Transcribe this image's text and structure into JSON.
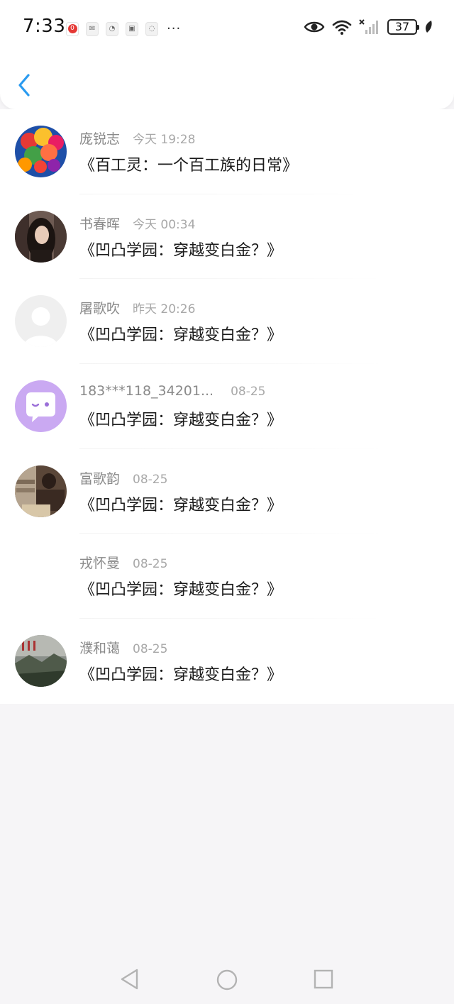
{
  "status_bar": {
    "time": "7:33",
    "notification_badge": "0",
    "more": "···",
    "battery": "37"
  },
  "colors": {
    "accent": "#2a9bf0",
    "name_text": "#8a8a8a",
    "time_text": "#a8a8a8"
  },
  "messages": [
    {
      "name": "庞锐志",
      "time": "今天 19:28",
      "text": "《百工灵：一个百工族的日常》"
    },
    {
      "name": "书春晖",
      "time": "今天 00:34",
      "text": "《凹凸学园：穿越变白金？》"
    },
    {
      "name": "屠歌吹",
      "time": "昨天 20:26",
      "text": "《凹凸学园：穿越变白金？》"
    },
    {
      "name": "183***118_34201...",
      "time": "08-25",
      "text": "《凹凸学园：穿越变白金？》"
    },
    {
      "name": "富歌韵",
      "time": "08-25",
      "text": "《凹凸学园：穿越变白金？》"
    },
    {
      "name": "戎怀曼",
      "time": "08-25",
      "text": "《凹凸学园：穿越变白金？》"
    },
    {
      "name": "濮和蔼",
      "time": "08-25",
      "text": "《凹凸学园：穿越变白金？》"
    }
  ]
}
